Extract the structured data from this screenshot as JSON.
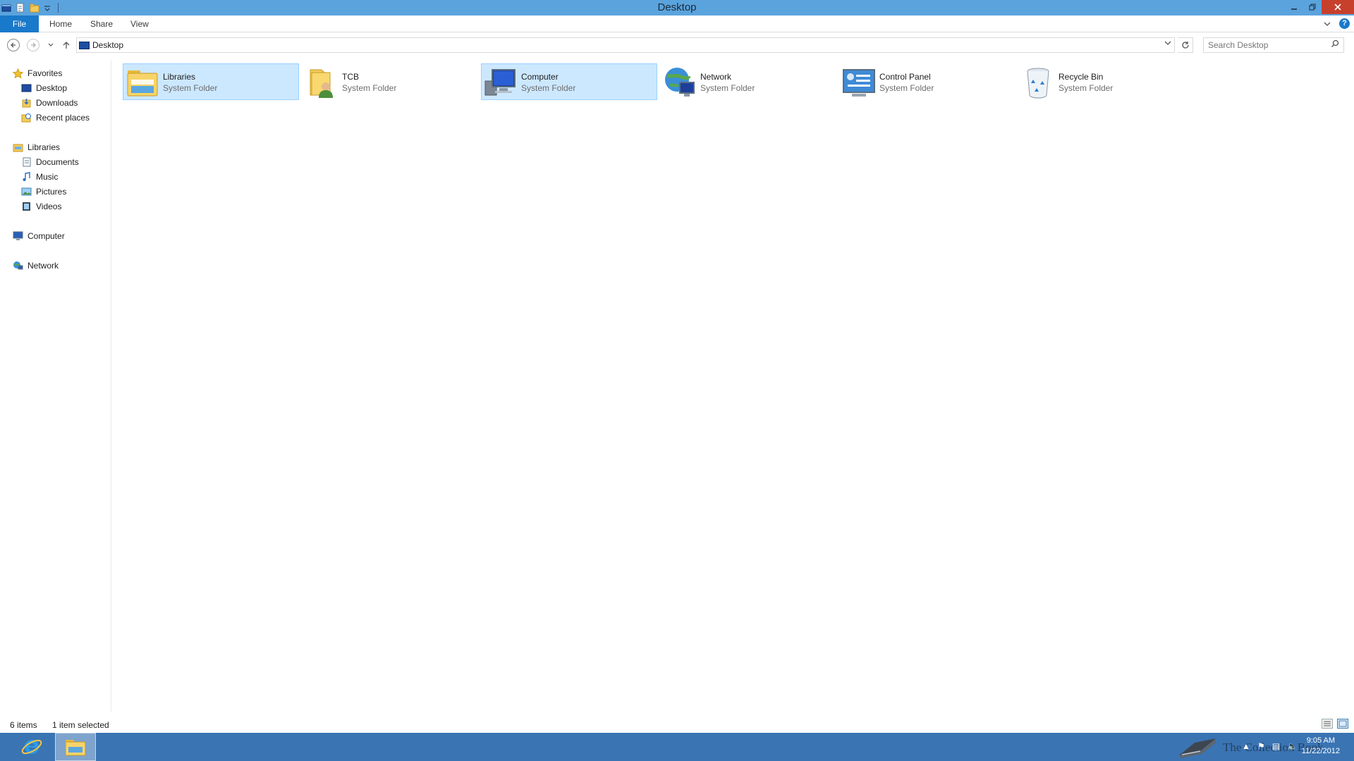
{
  "window": {
    "title": "Desktop"
  },
  "quick_access": [
    {
      "icon": "explorer-window-icon"
    },
    {
      "icon": "properties-icon"
    },
    {
      "icon": "new-folder-icon"
    },
    {
      "icon": "customize-toolbar-dropdown-icon"
    }
  ],
  "ribbon": {
    "tabs": [
      "File",
      "Home",
      "Share",
      "View"
    ],
    "active_tab_color": "#1979ca"
  },
  "address_bar": {
    "location": "Desktop",
    "search_placeholder": "Search Desktop"
  },
  "nav_pane": {
    "groups": [
      {
        "label": "Favorites",
        "icon": "star-icon",
        "children": [
          {
            "label": "Desktop",
            "icon": "desktop-icon"
          },
          {
            "label": "Downloads",
            "icon": "downloads-icon"
          },
          {
            "label": "Recent places",
            "icon": "recent-places-icon"
          }
        ]
      },
      {
        "label": "Libraries",
        "icon": "libraries-icon",
        "children": [
          {
            "label": "Documents",
            "icon": "documents-icon"
          },
          {
            "label": "Music",
            "icon": "music-icon"
          },
          {
            "label": "Pictures",
            "icon": "pictures-icon"
          },
          {
            "label": "Videos",
            "icon": "videos-icon"
          }
        ]
      },
      {
        "label": "Computer",
        "icon": "computer-icon",
        "children": []
      },
      {
        "label": "Network",
        "icon": "network-icon",
        "children": []
      }
    ]
  },
  "items": [
    {
      "name": "Libraries",
      "type": "System Folder",
      "icon": "libraries-folder-icon",
      "selected": true
    },
    {
      "name": "TCB",
      "type": "System Folder",
      "icon": "user-folder-icon",
      "selected": false
    },
    {
      "name": "Computer",
      "type": "System Folder",
      "icon": "computer-icon",
      "selected": true
    },
    {
      "name": "Network",
      "type": "System Folder",
      "icon": "network-globe-icon",
      "selected": false
    },
    {
      "name": "Control Panel",
      "type": "System Folder",
      "icon": "control-panel-icon",
      "selected": false
    },
    {
      "name": "Recycle Bin",
      "type": "System Folder",
      "icon": "recycle-bin-icon",
      "selected": false
    }
  ],
  "status": {
    "item_count": "6 items",
    "selection": "1 item selected"
  },
  "taskbar": {
    "watermark": "The Collection Book",
    "time": "9:05 AM",
    "date": "11/22/2012",
    "background": "#3a74b3"
  },
  "colors": {
    "titlebar": "#5ba3dd",
    "close_button": "#c7402c",
    "selection_fill": "#cce8ff",
    "selection_border": "#99d1ff"
  }
}
